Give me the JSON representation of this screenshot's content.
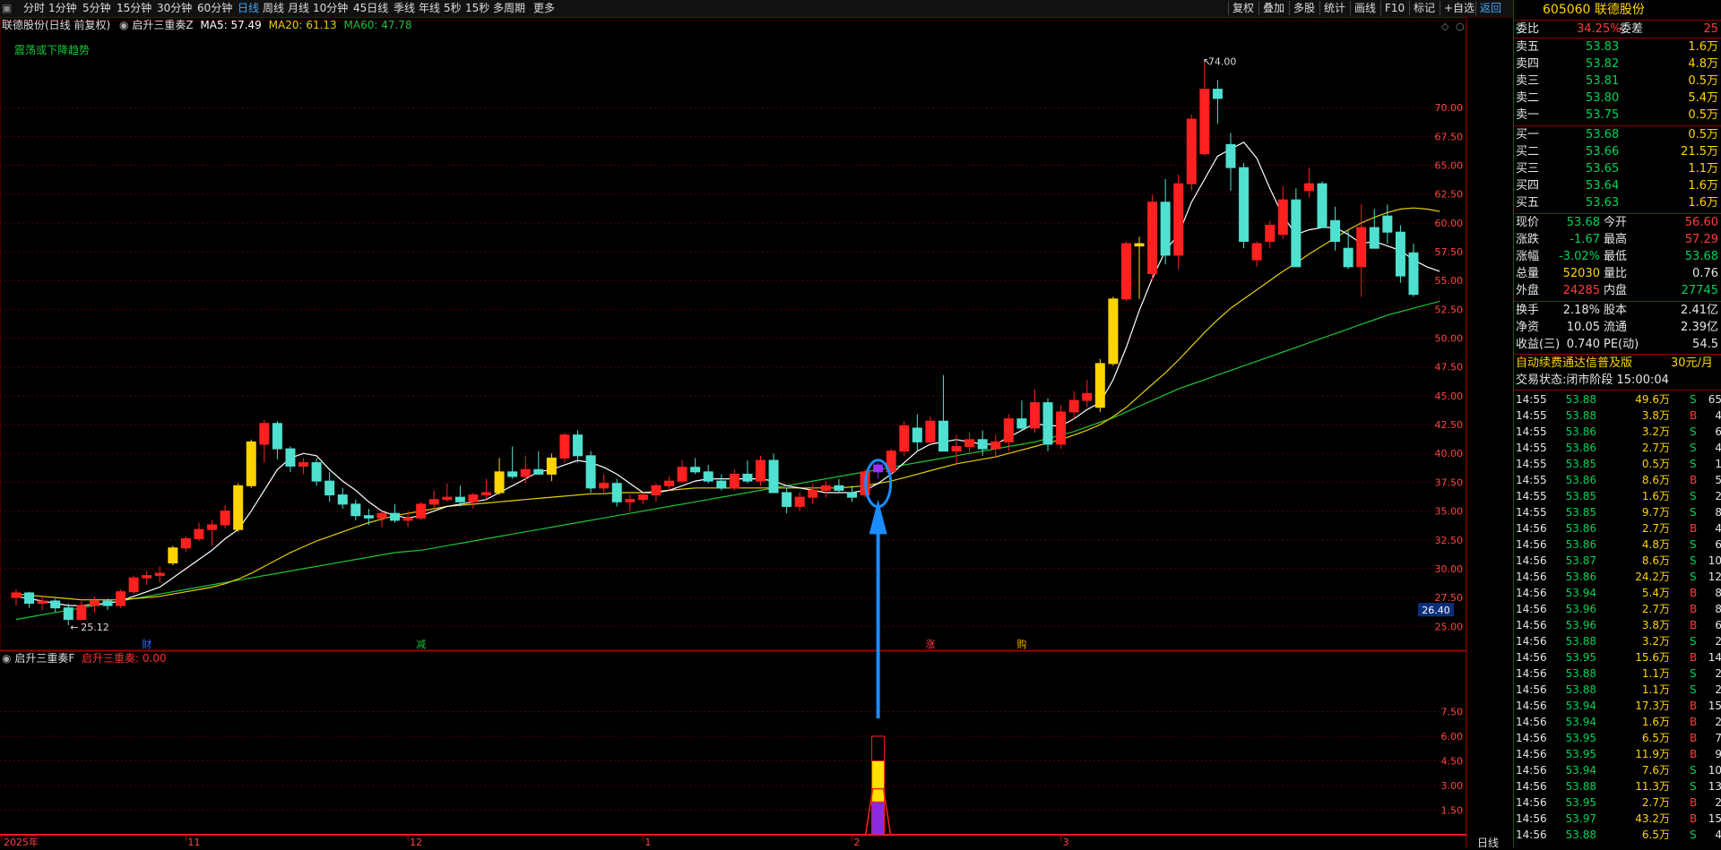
{
  "periods": [
    "分时",
    "1分钟",
    "5分钟",
    "15分钟",
    "30分钟",
    "60分钟",
    "日线",
    "周线",
    "月线",
    "10分钟",
    "45日线",
    "季线",
    "年线",
    "5秒",
    "15秒",
    "多周期",
    "更多"
  ],
  "active_period": "日线",
  "tools": [
    "复权",
    "叠加",
    "多股",
    "统计",
    "画线",
    "F10",
    "标记",
    "+自选",
    "返回"
  ],
  "main_header": {
    "stock": "联德股份(日线 前复权)",
    "indicator": "启升三重奏Z",
    "ma5_label": "MA5: 57.49",
    "ma20_label": "MA20: 61.13",
    "ma60_label": "MA60: 47.78",
    "trend_note": "震荡或下降趋势"
  },
  "indicator_header": {
    "name": "启升三重奏F",
    "value_label": "启升三重奏: 0.00"
  },
  "y_axis_labels": [
    "70.00",
    "67.50",
    "65.00",
    "62.50",
    "60.00",
    "57.50",
    "55.00",
    "52.50",
    "50.00",
    "47.50",
    "45.00",
    "42.50",
    "40.00",
    "37.50",
    "35.00",
    "32.50",
    "30.00",
    "27.50",
    "25.00"
  ],
  "price_tag": "26.40",
  "ind_axis_labels": [
    "7.50",
    "6.00",
    "4.50",
    "3.00",
    "1.50"
  ],
  "x_axis_labels": [
    "2025年",
    "11",
    "12",
    "1",
    "2",
    "3"
  ],
  "bottom_tab": "日线",
  "annotations": {
    "high": "74.00",
    "low": "25.12",
    "events": [
      "财",
      "减",
      "涨",
      "购"
    ]
  },
  "colors": {
    "up": "#ff2020",
    "down": "#4fe0d0",
    "limit": "#ffd400",
    "ma5": "#ffffff",
    "ma20": "#e6d000",
    "ma60": "#19c43a",
    "grid": "#5a0000"
  },
  "chart_data": {
    "type": "candlestick",
    "ohlc": [
      [
        27.5,
        28.2,
        26.8,
        27.9
      ],
      [
        27.9,
        28.0,
        26.6,
        27.0
      ],
      [
        27.0,
        27.6,
        26.4,
        27.2
      ],
      [
        27.2,
        27.4,
        26.2,
        26.6
      ],
      [
        26.6,
        27.0,
        25.1,
        25.6
      ],
      [
        25.6,
        27.2,
        25.5,
        26.8
      ],
      [
        26.8,
        27.6,
        26.2,
        27.2
      ],
      [
        27.2,
        27.4,
        26.4,
        26.8
      ],
      [
        26.8,
        28.2,
        26.6,
        28.0
      ],
      [
        28.0,
        29.4,
        27.8,
        29.2
      ],
      [
        29.2,
        29.8,
        28.6,
        29.4
      ],
      [
        29.4,
        30.2,
        28.8,
        29.6
      ],
      [
        30.5,
        32.0,
        30.3,
        31.8
      ],
      [
        31.8,
        32.8,
        31.5,
        32.6
      ],
      [
        32.6,
        34.0,
        32.4,
        33.4
      ],
      [
        33.4,
        34.2,
        32.0,
        33.8
      ],
      [
        33.8,
        35.5,
        33.5,
        35.0
      ],
      [
        33.4,
        37.4,
        33.2,
        37.2
      ],
      [
        37.2,
        41.2,
        37.0,
        41.0
      ],
      [
        40.8,
        42.9,
        39.2,
        42.6
      ],
      [
        42.6,
        42.8,
        39.5,
        40.4
      ],
      [
        40.4,
        40.6,
        38.4,
        38.9
      ],
      [
        38.9,
        39.6,
        38.2,
        39.2
      ],
      [
        39.2,
        39.6,
        37.2,
        37.6
      ],
      [
        37.6,
        38.4,
        35.8,
        36.4
      ],
      [
        36.4,
        37.0,
        35.2,
        35.6
      ],
      [
        35.6,
        36.0,
        34.2,
        34.6
      ],
      [
        34.6,
        35.2,
        33.8,
        34.4
      ],
      [
        34.4,
        35.0,
        33.6,
        34.8
      ],
      [
        34.8,
        35.6,
        34.0,
        34.2
      ],
      [
        34.2,
        35.0,
        33.6,
        34.4
      ],
      [
        34.4,
        35.8,
        34.2,
        35.6
      ],
      [
        35.6,
        36.8,
        35.2,
        36.0
      ],
      [
        36.0,
        37.4,
        35.8,
        36.2
      ],
      [
        36.2,
        37.2,
        35.4,
        35.8
      ],
      [
        35.8,
        36.6,
        35.2,
        36.4
      ],
      [
        36.4,
        37.8,
        36.0,
        36.6
      ],
      [
        36.6,
        39.6,
        36.4,
        38.4
      ],
      [
        38.4,
        40.6,
        37.8,
        38.0
      ],
      [
        38.0,
        39.8,
        37.4,
        38.6
      ],
      [
        38.6,
        40.2,
        38.2,
        38.2
      ],
      [
        38.2,
        40.0,
        37.6,
        39.6
      ],
      [
        39.6,
        41.8,
        39.2,
        41.6
      ],
      [
        41.6,
        42.0,
        39.2,
        39.8
      ],
      [
        39.8,
        40.2,
        36.6,
        37.0
      ],
      [
        37.0,
        38.2,
        36.6,
        37.4
      ],
      [
        37.4,
        37.8,
        35.4,
        35.8
      ],
      [
        35.8,
        36.4,
        35.0,
        36.0
      ],
      [
        36.0,
        36.6,
        35.6,
        36.4
      ],
      [
        36.4,
        37.4,
        35.8,
        37.2
      ],
      [
        37.2,
        38.0,
        36.8,
        37.6
      ],
      [
        37.6,
        39.4,
        37.4,
        38.8
      ],
      [
        38.8,
        39.6,
        38.2,
        38.4
      ],
      [
        38.4,
        39.0,
        37.4,
        37.6
      ],
      [
        37.6,
        38.2,
        36.8,
        37.0
      ],
      [
        37.0,
        38.6,
        36.8,
        38.2
      ],
      [
        38.2,
        39.4,
        37.4,
        37.6
      ],
      [
        37.6,
        39.8,
        37.2,
        39.4
      ],
      [
        39.4,
        40.0,
        36.8,
        36.6
      ],
      [
        36.6,
        37.0,
        34.8,
        35.4
      ],
      [
        35.4,
        36.6,
        35.0,
        36.2
      ],
      [
        36.2,
        37.4,
        35.6,
        36.8
      ],
      [
        36.8,
        37.6,
        36.2,
        37.2
      ],
      [
        37.2,
        37.8,
        36.6,
        36.8
      ],
      [
        36.6,
        37.2,
        35.8,
        36.2
      ],
      [
        36.4,
        38.6,
        36.2,
        38.4
      ],
      [
        38.4,
        39.2,
        37.8,
        39.0
      ],
      [
        38.4,
        40.4,
        38.2,
        40.2
      ],
      [
        40.2,
        42.8,
        39.8,
        42.4
      ],
      [
        42.2,
        43.4,
        40.2,
        41.0
      ],
      [
        41.0,
        43.2,
        40.8,
        42.8
      ],
      [
        42.8,
        46.8,
        41.2,
        40.2
      ],
      [
        40.2,
        41.6,
        39.0,
        40.6
      ],
      [
        40.6,
        41.8,
        40.0,
        41.2
      ],
      [
        41.2,
        42.0,
        39.8,
        40.4
      ],
      [
        40.4,
        41.6,
        39.6,
        41.0
      ],
      [
        41.0,
        43.4,
        40.2,
        43.0
      ],
      [
        43.0,
        44.6,
        42.0,
        42.2
      ],
      [
        42.2,
        45.6,
        41.8,
        44.4
      ],
      [
        44.4,
        44.8,
        40.2,
        40.8
      ],
      [
        40.8,
        44.2,
        40.4,
        43.6
      ],
      [
        43.6,
        45.4,
        43.0,
        44.6
      ],
      [
        44.6,
        46.4,
        44.0,
        45.2
      ],
      [
        44.0,
        48.2,
        43.6,
        47.8
      ],
      [
        47.8,
        53.6,
        47.6,
        53.4
      ],
      [
        53.4,
        58.4,
        53.2,
        58.2
      ],
      [
        58.2,
        58.8,
        53.4,
        58.0
      ],
      [
        55.6,
        62.4,
        55.0,
        61.8
      ],
      [
        61.8,
        63.8,
        56.4,
        57.2
      ],
      [
        57.2,
        64.2,
        56.0,
        63.4
      ],
      [
        63.4,
        69.4,
        62.8,
        69.0
      ],
      [
        66.0,
        74.0,
        65.8,
        71.6
      ],
      [
        71.6,
        72.4,
        68.6,
        70.8
      ],
      [
        66.8,
        67.8,
        62.8,
        64.8
      ],
      [
        64.8,
        65.2,
        57.8,
        58.4
      ],
      [
        56.8,
        58.4,
        56.2,
        58.2
      ],
      [
        58.4,
        60.2,
        57.8,
        59.8
      ],
      [
        59.0,
        63.2,
        58.6,
        62.0
      ],
      [
        62.0,
        63.0,
        56.6,
        56.2
      ],
      [
        62.8,
        64.8,
        62.2,
        63.4
      ],
      [
        63.4,
        63.6,
        59.8,
        59.6
      ],
      [
        60.2,
        61.4,
        57.6,
        58.4
      ],
      [
        57.8,
        59.4,
        56.0,
        56.2
      ],
      [
        56.2,
        61.6,
        53.6,
        59.6
      ],
      [
        59.6,
        61.2,
        58.6,
        57.8
      ],
      [
        60.6,
        61.6,
        58.2,
        59.2
      ],
      [
        59.2,
        59.8,
        54.8,
        55.4
      ],
      [
        57.4,
        58.2,
        53.6,
        53.8
      ]
    ],
    "ma5": [
      27.6,
      27.4,
      27.2,
      27.0,
      26.8,
      26.8,
      26.9,
      27.0,
      27.2,
      27.6,
      28.0,
      28.4,
      29.2,
      30.0,
      30.8,
      31.6,
      32.6,
      33.4,
      35.0,
      36.8,
      38.6,
      39.6,
      40.0,
      39.8,
      38.6,
      37.6,
      36.8,
      35.8,
      35.0,
      34.6,
      34.4,
      34.6,
      35.0,
      35.4,
      35.6,
      35.8,
      36.0,
      36.6,
      37.2,
      37.8,
      38.4,
      38.6,
      39.0,
      39.4,
      39.2,
      38.8,
      38.2,
      37.4,
      36.6,
      36.6,
      36.8,
      37.2,
      37.6,
      37.8,
      37.8,
      37.8,
      37.8,
      37.8,
      37.6,
      37.2,
      37.0,
      36.8,
      36.6,
      36.6,
      36.6,
      36.8,
      37.4,
      38.2,
      39.2,
      40.2,
      40.8,
      41.0,
      41.2,
      41.0,
      40.8,
      40.8,
      41.4,
      42.0,
      42.6,
      42.4,
      42.4,
      43.0,
      43.8,
      44.4,
      46.4,
      49.2,
      52.4,
      55.2,
      57.6,
      59.0,
      61.8,
      63.8,
      65.8,
      66.4,
      67.0,
      65.6,
      63.0,
      60.6,
      59.0,
      59.4,
      59.6,
      59.6,
      59.0,
      58.2,
      58.4,
      58.0,
      57.6,
      56.8,
      56.2,
      55.8
    ],
    "ma20": [
      27.8,
      27.7,
      27.6,
      27.5,
      27.4,
      27.3,
      27.3,
      27.3,
      27.3,
      27.4,
      27.5,
      27.6,
      27.8,
      28.0,
      28.2,
      28.4,
      28.7,
      29.1,
      29.6,
      30.2,
      30.8,
      31.4,
      31.9,
      32.4,
      32.8,
      33.2,
      33.6,
      34.0,
      34.3,
      34.6,
      34.8,
      35.0,
      35.2,
      35.4,
      35.5,
      35.6,
      35.7,
      35.8,
      35.9,
      36.0,
      36.1,
      36.2,
      36.3,
      36.4,
      36.5,
      36.5,
      36.6,
      36.6,
      36.6,
      36.7,
      36.8,
      36.9,
      37.0,
      37.0,
      37.0,
      37.0,
      37.0,
      37.0,
      37.0,
      37.0,
      37.0,
      37.0,
      37.0,
      37.0,
      37.1,
      37.2,
      37.4,
      37.6,
      37.9,
      38.2,
      38.5,
      38.8,
      39.1,
      39.3,
      39.5,
      39.7,
      40.0,
      40.3,
      40.6,
      40.9,
      41.2,
      41.6,
      42.0,
      42.5,
      43.2,
      44.0,
      45.0,
      46.0,
      47.0,
      48.1,
      49.3,
      50.5,
      51.6,
      52.6,
      53.4,
      54.2,
      55.0,
      55.8,
      56.5,
      57.3,
      58.0,
      58.7,
      59.4,
      60.0,
      60.5,
      60.9,
      61.2,
      61.3,
      61.2,
      61.0
    ],
    "ma60": [
      25.6,
      25.8,
      26.0,
      26.2,
      26.4,
      26.6,
      26.8,
      27.0,
      27.2,
      27.4,
      27.6,
      27.8,
      28.0,
      28.2,
      28.4,
      28.6,
      28.8,
      29.0,
      29.2,
      29.4,
      29.6,
      29.8,
      30.0,
      30.2,
      30.4,
      30.6,
      30.8,
      31.0,
      31.2,
      31.4,
      31.5,
      31.6,
      31.8,
      32.0,
      32.2,
      32.4,
      32.6,
      32.8,
      33.0,
      33.2,
      33.4,
      33.6,
      33.8,
      34.0,
      34.2,
      34.4,
      34.6,
      34.8,
      35.0,
      35.2,
      35.4,
      35.6,
      35.8,
      36.0,
      36.2,
      36.4,
      36.6,
      36.8,
      37.0,
      37.2,
      37.4,
      37.6,
      37.8,
      38.0,
      38.2,
      38.4,
      38.6,
      38.8,
      39.0,
      39.2,
      39.4,
      39.6,
      39.8,
      40.0,
      40.2,
      40.4,
      40.6,
      40.8,
      41.0,
      41.3,
      41.6,
      41.9,
      42.3,
      42.7,
      43.1,
      43.6,
      44.1,
      44.6,
      45.1,
      45.6,
      46.0,
      46.4,
      46.8,
      47.2,
      47.6,
      48.0,
      48.4,
      48.8,
      49.2,
      49.6,
      50.0,
      50.4,
      50.8,
      51.2,
      51.6,
      52.0,
      52.3,
      52.6,
      52.9,
      53.2
    ],
    "signal": {
      "index": 66,
      "value": 6.0
    },
    "ylim": [
      23.0,
      76.0
    ],
    "ind_ylim": [
      0,
      9
    ]
  },
  "quote": {
    "code_name": "605060 联德股份",
    "weibi_label": "委比",
    "weibi": "34.25%",
    "weicha_label": "委差",
    "weicha": "25",
    "asks": [
      [
        "卖五",
        "53.83",
        "1.6万"
      ],
      [
        "卖四",
        "53.82",
        "4.8万"
      ],
      [
        "卖三",
        "53.81",
        "0.5万"
      ],
      [
        "卖二",
        "53.80",
        "5.4万"
      ],
      [
        "卖一",
        "53.75",
        "0.5万"
      ]
    ],
    "bids": [
      [
        "买一",
        "53.68",
        "0.5万"
      ],
      [
        "买二",
        "53.66",
        "21.5万"
      ],
      [
        "买三",
        "53.65",
        "1.1万"
      ],
      [
        "买四",
        "53.64",
        "1.6万"
      ],
      [
        "买五",
        "53.63",
        "1.6万"
      ]
    ],
    "stats1": [
      [
        "现价",
        "53.68",
        "今开",
        "56.60"
      ],
      [
        "涨跌",
        "-1.67",
        "最高",
        "57.29"
      ],
      [
        "涨幅",
        "-3.02%",
        "最低",
        "53.68"
      ],
      [
        "总量",
        "52030",
        "量比",
        "0.76"
      ],
      [
        "外盘",
        "24285",
        "内盘",
        "27745"
      ]
    ],
    "stats2": [
      [
        "换手",
        "2.18%",
        "股本",
        "2.41亿"
      ],
      [
        "净资",
        "10.05",
        "流通",
        "2.39亿"
      ],
      [
        "收益(三)",
        "0.740",
        "PE(动)",
        "54.5"
      ]
    ],
    "promo": "自动续费通达信普及版",
    "promo_price": "30元/月",
    "status": "交易状态:闭市阶段 15:00:04"
  },
  "trades": [
    [
      "14:55",
      "53.88",
      "49.6万",
      "S",
      "65"
    ],
    [
      "14:55",
      "53.88",
      "3.8万",
      "B",
      "4"
    ],
    [
      "14:55",
      "53.86",
      "3.2万",
      "S",
      "6"
    ],
    [
      "14:55",
      "53.86",
      "2.7万",
      "S",
      "4"
    ],
    [
      "14:55",
      "53.85",
      "0.5万",
      "S",
      "1"
    ],
    [
      "14:55",
      "53.86",
      "8.6万",
      "B",
      "5"
    ],
    [
      "14:55",
      "53.85",
      "1.6万",
      "S",
      "2"
    ],
    [
      "14:55",
      "53.85",
      "9.7万",
      "S",
      "8"
    ],
    [
      "14:56",
      "53.86",
      "2.7万",
      "B",
      "4"
    ],
    [
      "14:56",
      "53.86",
      "4.8万",
      "S",
      "6"
    ],
    [
      "14:56",
      "53.87",
      "8.6万",
      "S",
      "10"
    ],
    [
      "14:56",
      "53.86",
      "24.2万",
      "S",
      "12"
    ],
    [
      "14:56",
      "53.94",
      "5.4万",
      "B",
      "8"
    ],
    [
      "14:56",
      "53.96",
      "2.7万",
      "B",
      "8"
    ],
    [
      "14:56",
      "53.96",
      "3.8万",
      "B",
      "6"
    ],
    [
      "14:56",
      "53.88",
      "3.2万",
      "S",
      "2"
    ],
    [
      "14:56",
      "53.95",
      "15.6万",
      "B",
      "14"
    ],
    [
      "14:56",
      "53.88",
      "1.1万",
      "S",
      "2"
    ],
    [
      "14:56",
      "53.88",
      "1.1万",
      "S",
      "2"
    ],
    [
      "14:56",
      "53.94",
      "17.3万",
      "B",
      "15"
    ],
    [
      "14:56",
      "53.94",
      "1.6万",
      "B",
      "2"
    ],
    [
      "14:56",
      "53.95",
      "6.5万",
      "B",
      "7"
    ],
    [
      "14:56",
      "53.95",
      "11.9万",
      "B",
      "9"
    ],
    [
      "14:56",
      "53.94",
      "7.6万",
      "S",
      "10"
    ],
    [
      "14:56",
      "53.88",
      "11.3万",
      "S",
      "13"
    ],
    [
      "14:56",
      "53.95",
      "2.7万",
      "B",
      "2"
    ],
    [
      "14:56",
      "53.97",
      "43.2万",
      "B",
      "15"
    ],
    [
      "14:56",
      "53.88",
      "6.5万",
      "S",
      "4"
    ]
  ]
}
